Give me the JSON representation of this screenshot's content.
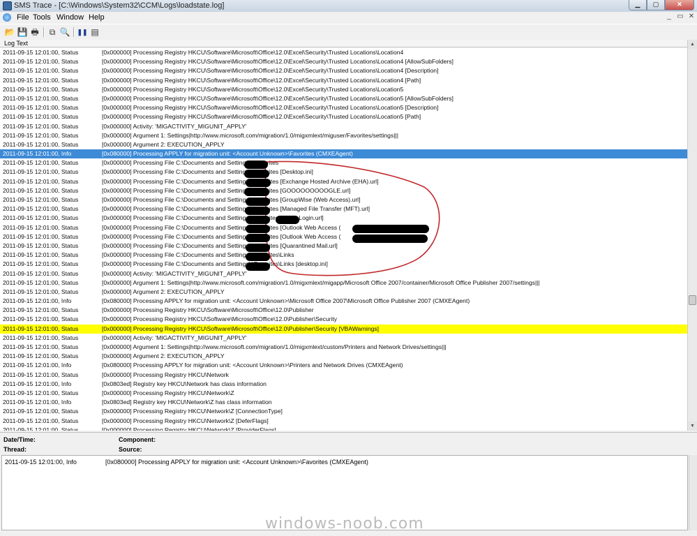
{
  "window": {
    "title": "SMS Trace - [C:\\Windows\\System32\\CCM\\Logs\\loadstate.log]"
  },
  "menu": [
    {
      "name": "menu-file",
      "label": "File",
      "accel": "F"
    },
    {
      "name": "menu-tools",
      "label": "Tools",
      "accel": "T"
    },
    {
      "name": "menu-window",
      "label": "Window",
      "accel": "W"
    },
    {
      "name": "menu-help",
      "label": "Help",
      "accel": "H"
    }
  ],
  "toolbar": [
    {
      "icon": "open-folder-icon",
      "glyph": "📂"
    },
    {
      "icon": "save-icon",
      "glyph": "💾"
    },
    {
      "icon": "print-icon",
      "glyph": "🖶"
    },
    {
      "icon": "copy-icon",
      "glyph": "⧉"
    },
    {
      "icon": "find-icon",
      "glyph": "🔍"
    },
    {
      "icon": "pause-icon",
      "glyph": "❚❚"
    },
    {
      "icon": "details-pane-icon",
      "glyph": "▤"
    }
  ],
  "log": {
    "column_header": "Log Text",
    "rows": [
      {
        "dt": "2011-09-15 12:01:00, Status",
        "msg": "[0x000000] Processing Registry HKCU\\Software\\Microsoft\\Office\\12.0\\Excel\\Security\\Trusted Locations\\Location4"
      },
      {
        "dt": "2011-09-15 12:01:00, Status",
        "msg": "[0x000000] Processing Registry HKCU\\Software\\Microsoft\\Office\\12.0\\Excel\\Security\\Trusted Locations\\Location4 [AllowSubFolders]"
      },
      {
        "dt": "2011-09-15 12:01:00, Status",
        "msg": "[0x000000] Processing Registry HKCU\\Software\\Microsoft\\Office\\12.0\\Excel\\Security\\Trusted Locations\\Location4 [Description]"
      },
      {
        "dt": "2011-09-15 12:01:00, Status",
        "msg": "[0x000000] Processing Registry HKCU\\Software\\Microsoft\\Office\\12.0\\Excel\\Security\\Trusted Locations\\Location4 [Path]"
      },
      {
        "dt": "2011-09-15 12:01:00, Status",
        "msg": "[0x000000] Processing Registry HKCU\\Software\\Microsoft\\Office\\12.0\\Excel\\Security\\Trusted Locations\\Location5"
      },
      {
        "dt": "2011-09-15 12:01:00, Status",
        "msg": "[0x000000] Processing Registry HKCU\\Software\\Microsoft\\Office\\12.0\\Excel\\Security\\Trusted Locations\\Location5 [AllowSubFolders]"
      },
      {
        "dt": "2011-09-15 12:01:00, Status",
        "msg": "[0x000000] Processing Registry HKCU\\Software\\Microsoft\\Office\\12.0\\Excel\\Security\\Trusted Locations\\Location5 [Description]"
      },
      {
        "dt": "2011-09-15 12:01:00, Status",
        "msg": "[0x000000] Processing Registry HKCU\\Software\\Microsoft\\Office\\12.0\\Excel\\Security\\Trusted Locations\\Location5 [Path]"
      },
      {
        "dt": "2011-09-15 12:01:00, Status",
        "msg": "[0x000000] Activity: 'MIGACTIVITY_MIGUNIT_APPLY'"
      },
      {
        "dt": "2011-09-15 12:01:00, Status",
        "msg": "[0x000000]   Argument 1: Settings|http://www.microsoft.com/migration/1.0/migxmlext/miguser/Favorites/settings|||"
      },
      {
        "dt": "2011-09-15 12:01:00, Status",
        "msg": "[0x000000]   Argument 2: EXECUTION_APPLY"
      },
      {
        "dt": "2011-09-15 12:01:00, Info",
        "msg": "[0x080000] Processing APPLY for migration unit: <Account Unknown>\\Favorites (CMXEAgent)",
        "state": "selected"
      },
      {
        "dt": "2011-09-15 12:01:00, Status",
        "msg": "[0x000000] Processing File C:\\Documents and Settings\\            \\Favorites"
      },
      {
        "dt": "2011-09-15 12:01:00, Status",
        "msg": "[0x000000] Processing File C:\\Documents and Settings\\            \\Favorites [Desktop.ini]"
      },
      {
        "dt": "2011-09-15 12:01:00, Status",
        "msg": "[0x000000] Processing File C:\\Documents and Settings\\            \\Favorites [Exchange Hosted Archive (EHA).url]"
      },
      {
        "dt": "2011-09-15 12:01:00, Status",
        "msg": "[0x000000] Processing File C:\\Documents and Settings\\            \\Favorites [GOOOOOOOOOGLE.url]"
      },
      {
        "dt": "2011-09-15 12:01:00, Status",
        "msg": "[0x000000] Processing File C:\\Documents and Settings\\            \\Favorites [GroupWise (Web Access).url]"
      },
      {
        "dt": "2011-09-15 12:01:00, Status",
        "msg": "[0x000000] Processing File C:\\Documents and Settings\\            \\Favorites [Managed File Transfer (MFT).url]"
      },
      {
        "dt": "2011-09-15 12:01:00, Status",
        "msg": "[0x000000] Processing File C:\\Documents and Settings\\            \\Favorites [           Citrix Login.url]"
      },
      {
        "dt": "2011-09-15 12:01:00, Status",
        "msg": "[0x000000] Processing File C:\\Documents and Settings\\            \\Favorites [Outlook Web Access ("
      },
      {
        "dt": "2011-09-15 12:01:00, Status",
        "msg": "[0x000000] Processing File C:\\Documents and Settings\\            \\Favorites [Outlook Web Access ("
      },
      {
        "dt": "2011-09-15 12:01:00, Status",
        "msg": "[0x000000] Processing File C:\\Documents and Settings\\            \\Favorites [Quarantined Mail.url]"
      },
      {
        "dt": "2011-09-15 12:01:00, Status",
        "msg": "[0x000000] Processing File C:\\Documents and Settings\\            \\Favorites\\Links"
      },
      {
        "dt": "2011-09-15 12:01:00, Status",
        "msg": "[0x000000] Processing File C:\\Documents and Settings\\            \\Favorites\\Links [desktop.ini]"
      },
      {
        "dt": "2011-09-15 12:01:00, Status",
        "msg": "[0x000000] Activity: 'MIGACTIVITY_MIGUNIT_APPLY'"
      },
      {
        "dt": "2011-09-15 12:01:00, Status",
        "msg": "[0x000000]   Argument 1: Settings|http://www.microsoft.com/migration/1.0/migxmlext/migapp/Microsoft Office 2007/container/Microsoft Office Publisher 2007/settings|||"
      },
      {
        "dt": "2011-09-15 12:01:00, Status",
        "msg": "[0x000000]   Argument 2: EXECUTION_APPLY"
      },
      {
        "dt": "2011-09-15 12:01:00, Info",
        "msg": "[0x080000] Processing APPLY for migration unit: <Account Unknown>\\Microsoft Office 2007\\Microsoft Office Publisher 2007 (CMXEAgent)"
      },
      {
        "dt": "2011-09-15 12:01:00, Status",
        "msg": "[0x000000] Processing Registry HKCU\\Software\\Microsoft\\Office\\12.0\\Publisher"
      },
      {
        "dt": "2011-09-15 12:01:00, Status",
        "msg": "[0x000000] Processing Registry HKCU\\Software\\Microsoft\\Office\\12.0\\Publisher\\Security"
      },
      {
        "dt": "2011-09-15 12:01:00, Status",
        "msg": "[0x000000] Processing Registry HKCU\\Software\\Microsoft\\Office\\12.0\\Publisher\\Security [VBAWarnings]",
        "state": "highlight"
      },
      {
        "dt": "2011-09-15 12:01:00, Status",
        "msg": "[0x000000] Activity: 'MIGACTIVITY_MIGUNIT_APPLY'"
      },
      {
        "dt": "2011-09-15 12:01:00, Status",
        "msg": "[0x000000]   Argument 1: Settings|http://www.microsoft.com/migration/1.0/migxmlext/custom/Printers and Network Drives/settings|||"
      },
      {
        "dt": "2011-09-15 12:01:00, Status",
        "msg": "[0x000000]   Argument 2: EXECUTION_APPLY"
      },
      {
        "dt": "2011-09-15 12:01:00, Info",
        "msg": "[0x080000] Processing APPLY for migration unit: <Account Unknown>\\Printers and Network Drives (CMXEAgent)"
      },
      {
        "dt": "2011-09-15 12:01:00, Status",
        "msg": "[0x000000] Processing Registry HKCU\\Network"
      },
      {
        "dt": "2011-09-15 12:01:00, Info",
        "msg": "[0x0803ed] Registry key HKCU\\Network has class information"
      },
      {
        "dt": "2011-09-15 12:01:00, Status",
        "msg": "[0x000000] Processing Registry HKCU\\Network\\Z"
      },
      {
        "dt": "2011-09-15 12:01:00, Info",
        "msg": "[0x0803ed] Registry key HKCU\\Network\\Z has class information"
      },
      {
        "dt": "2011-09-15 12:01:00, Status",
        "msg": "[0x000000] Processing Registry HKCU\\Network\\Z [ConnectionType]"
      },
      {
        "dt": "2011-09-15 12:01:00, Status",
        "msg": "[0x000000] Processing Registry HKCU\\Network\\Z [DeferFlags]"
      },
      {
        "dt": "2011-09-15 12:01:00, Status",
        "msg": "[0x000000] Processing Registry HKCU\\Network\\Z [ProviderFlags]"
      }
    ]
  },
  "details": {
    "datetime_label": "Date/Time:",
    "component_label": "Component:",
    "thread_label": "Thread:",
    "source_label": "Source:",
    "text_dt": "2011-09-15 12:01:00, Info",
    "text_msg": "[0x080000] Processing APPLY for migration unit: <Account Unknown>\\Favorites (CMXEAgent)"
  },
  "watermark": "windows-noob.com",
  "colors": {
    "selection": "#3d8ad6",
    "highlight": "#ffff00",
    "annotation": "#c0282b"
  }
}
